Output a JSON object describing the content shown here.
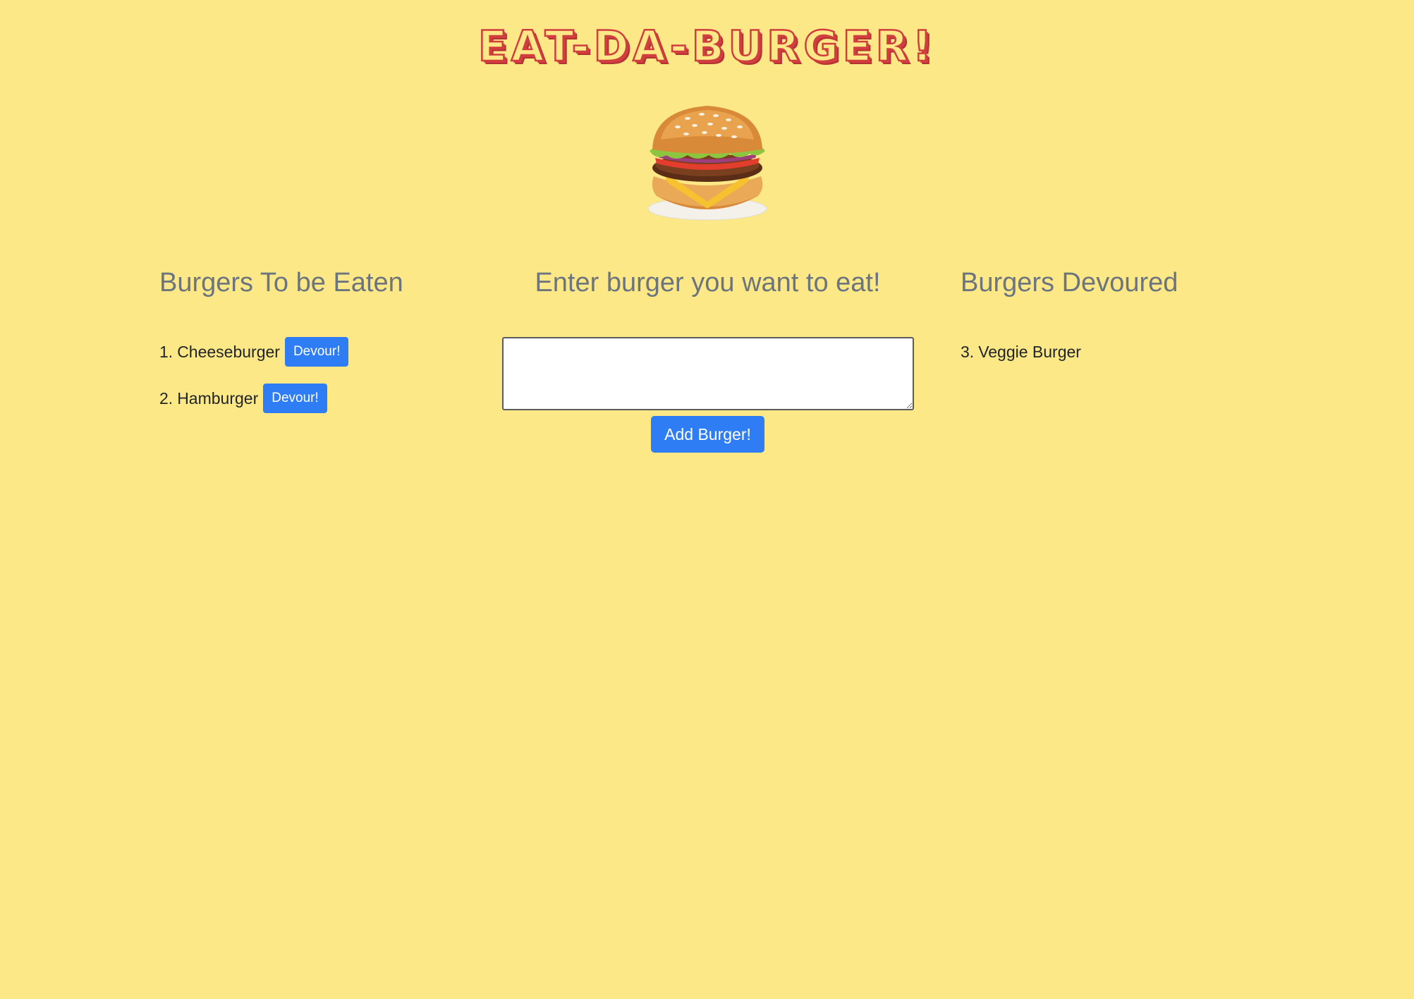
{
  "header": {
    "title": "EAT-DA-BURGER!",
    "image_icon": "burger-image"
  },
  "left_column": {
    "heading": "Burgers To be Eaten",
    "items": [
      {
        "number": "1.",
        "name": "Cheeseburger",
        "button_label": "Devour!"
      },
      {
        "number": "2.",
        "name": "Hamburger",
        "button_label": "Devour!"
      }
    ]
  },
  "middle_column": {
    "heading": "Enter burger you want to eat!",
    "input_value": "",
    "input_placeholder": "",
    "submit_label": "Add Burger!"
  },
  "right_column": {
    "heading": "Burgers Devoured",
    "items": [
      {
        "number": "3.",
        "name": "Veggie Burger"
      }
    ]
  },
  "colors": {
    "background": "#fce886",
    "title_red": "#d03e3e",
    "heading_gray": "#6c757d",
    "button_blue": "#2f7df4"
  }
}
